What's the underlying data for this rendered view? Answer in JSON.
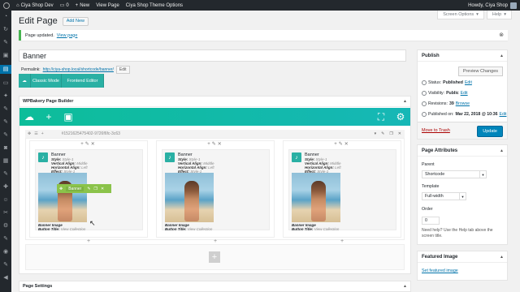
{
  "adminbar": {
    "site_name": "Ciya Shop Dev",
    "comments_count": "0",
    "new_label": "New",
    "view_page": "View Page",
    "theme_options": "Ciya Shop Theme Options",
    "howdy": "Howdy, Ciya Shop"
  },
  "screen_options": {
    "screen_options_label": "Screen Options",
    "help_label": "Help"
  },
  "header": {
    "title": "Edit Page",
    "add_new": "Add New"
  },
  "notice": {
    "text": "Page updated.",
    "link": "View page"
  },
  "post": {
    "title": "Banner",
    "permalink_label": "Permalink:",
    "permalink_url": "http://ciya-shop.local/shortcode/banner/",
    "permalink_edit": "Edit"
  },
  "mode_buttons": {
    "classic": "Classic Mode",
    "frontend": "Frontend Editor"
  },
  "wpbakery": {
    "title": "WPBakery Page Builder",
    "row_id": "#1521625475402-9726f6fc-3c63",
    "columns": [
      {
        "title": "Banner",
        "props": [
          {
            "key": "Style:",
            "val": "Style-1"
          },
          {
            "key": "Vertical Align:",
            "val": "Middle"
          },
          {
            "key": "Horizontal Align:",
            "val": "Left"
          },
          {
            "key": "Effect:",
            "val": "Style-1"
          }
        ],
        "footer": [
          {
            "key": "Banner Image",
            "val": ""
          },
          {
            "key": "Button Title:",
            "val": "View Collection"
          }
        ]
      },
      {
        "title": "Banner",
        "props": [
          {
            "key": "Style:",
            "val": "Style-1"
          },
          {
            "key": "Vertical Align:",
            "val": "Middle"
          },
          {
            "key": "Horizontal Align:",
            "val": "Left"
          },
          {
            "key": "Effect:",
            "val": "Style-1"
          }
        ],
        "footer": [
          {
            "key": "Banner Image",
            "val": ""
          },
          {
            "key": "Button Title:",
            "val": "View Collection"
          }
        ]
      },
      {
        "title": "Banner",
        "props": [
          {
            "key": "Style:",
            "val": "Style-1"
          },
          {
            "key": "Vertical Align:",
            "val": "Middle"
          },
          {
            "key": "Horizontal Align:",
            "val": "Left"
          },
          {
            "key": "Effect:",
            "val": "Style-1"
          }
        ],
        "footer": [
          {
            "key": "Banner Image",
            "val": ""
          },
          {
            "key": "Button Title:",
            "val": "View Collection"
          }
        ]
      }
    ],
    "element_toolbar_label": "Banner"
  },
  "page_settings": {
    "title": "Page Settings"
  },
  "publish": {
    "title": "Publish",
    "preview": "Preview Changes",
    "status_label": "Status:",
    "status_value": "Published",
    "visibility_label": "Visibility:",
    "visibility_value": "Public",
    "revisions_label": "Revisions:",
    "revisions_value": "39",
    "browse": "Browse",
    "published_label": "Published on:",
    "published_value": "Mar 22, 2018 @ 10:36",
    "edit": "Edit",
    "trash": "Move to Trash",
    "update": "Update"
  },
  "page_attributes": {
    "title": "Page Attributes",
    "parent_label": "Parent",
    "parent_value": "Shortcode",
    "template_label": "Template",
    "template_value": "Full-width",
    "order_label": "Order",
    "order_value": "0",
    "help": "Need help? Use the Help tab above the screen title."
  },
  "featured": {
    "title": "Featured Image",
    "link": "Set featured image"
  },
  "colors": {
    "accent": "#0073aa",
    "wpbakery": "#0dbd9a",
    "notice": "#46b450",
    "toolbar": "#8bc34a"
  }
}
